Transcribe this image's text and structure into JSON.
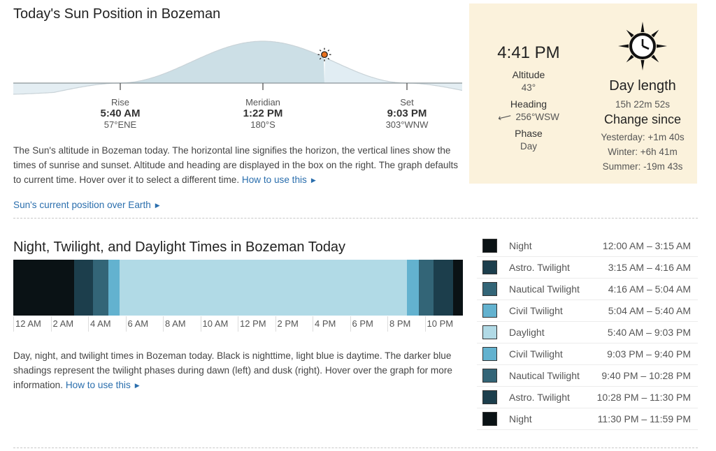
{
  "sun_position": {
    "title": "Today's Sun Position in Bozeman",
    "events": [
      {
        "label": "Rise",
        "time": "5:40 AM",
        "direction": "57°ENE"
      },
      {
        "label": "Meridian",
        "time": "1:22 PM",
        "direction": "180°S"
      },
      {
        "label": "Set",
        "time": "9:03 PM",
        "direction": "303°WNW"
      }
    ],
    "description": "The Sun's altitude in Bozeman today. The horizontal line signifies the horizon, the vertical lines show the times of sunrise and sunset. Altitude and heading are displayed in the box on the right. The graph defaults to current time. Hover over it to select a different time.",
    "how_to_link": "How to use this",
    "earth_link": "Sun's current position over Earth",
    "current_time_fraction": 0.695
  },
  "info_box": {
    "current_time": "4:41 PM",
    "altitude_label": "Altitude",
    "altitude_value": "43°",
    "heading_label": "Heading",
    "heading_value": "256°WSW",
    "phase_label": "Phase",
    "phase_value": "Day",
    "day_length_label": "Day length",
    "day_length_value": "15h 22m 52s",
    "change_label": "Change since",
    "yesterday": "Yesterday: +1m 40s",
    "winter": "Winter: +6h 41m",
    "summer": "Summer: -19m 43s",
    "icon": "sun-clock-icon"
  },
  "twilight": {
    "title": "Night, Twilight, and Daylight Times in Bozeman Today",
    "description": "Day, night, and twilight times in Bozeman today. Black is nighttime, light blue is daytime. The darker blue shadings represent the twilight phases during dawn (left) and dusk (right). Hover over the graph for more information.",
    "how_to_link": "How to use this",
    "colors": {
      "night": "#0a1215",
      "astro": "#1c3e4c",
      "nautical": "#336577",
      "civil": "#63b2cf",
      "day": "#b1dae6"
    },
    "ticks": [
      "12 AM",
      "2 AM",
      "4 AM",
      "6 AM",
      "8 AM",
      "10 AM",
      "12 PM",
      "2 PM",
      "4 PM",
      "6 PM",
      "8 PM",
      "10 PM"
    ],
    "segments": [
      {
        "phase": "night",
        "start_min": 0,
        "end_min": 195
      },
      {
        "phase": "astro",
        "start_min": 195,
        "end_min": 256
      },
      {
        "phase": "nautical",
        "start_min": 256,
        "end_min": 304
      },
      {
        "phase": "civil",
        "start_min": 304,
        "end_min": 340
      },
      {
        "phase": "day",
        "start_min": 340,
        "end_min": 1263
      },
      {
        "phase": "civil",
        "start_min": 1263,
        "end_min": 1300
      },
      {
        "phase": "nautical",
        "start_min": 1300,
        "end_min": 1348
      },
      {
        "phase": "astro",
        "start_min": 1348,
        "end_min": 1410
      },
      {
        "phase": "night",
        "start_min": 1410,
        "end_min": 1440
      }
    ],
    "legend": [
      {
        "name": "Night",
        "range": "12:00 AM – 3:15 AM",
        "phase": "night"
      },
      {
        "name": "Astro. Twilight",
        "range": "3:15 AM – 4:16 AM",
        "phase": "astro"
      },
      {
        "name": "Nautical Twilight",
        "range": "4:16 AM – 5:04 AM",
        "phase": "nautical"
      },
      {
        "name": "Civil Twilight",
        "range": "5:04 AM – 5:40 AM",
        "phase": "civil"
      },
      {
        "name": "Daylight",
        "range": "5:40 AM – 9:03 PM",
        "phase": "day"
      },
      {
        "name": "Civil Twilight",
        "range": "9:03 PM – 9:40 PM",
        "phase": "civil"
      },
      {
        "name": "Nautical Twilight",
        "range": "9:40 PM – 10:28 PM",
        "phase": "nautical"
      },
      {
        "name": "Astro. Twilight",
        "range": "10:28 PM – 11:30 PM",
        "phase": "astro"
      },
      {
        "name": "Night",
        "range": "11:30 PM – 11:59 PM",
        "phase": "night"
      }
    ]
  }
}
